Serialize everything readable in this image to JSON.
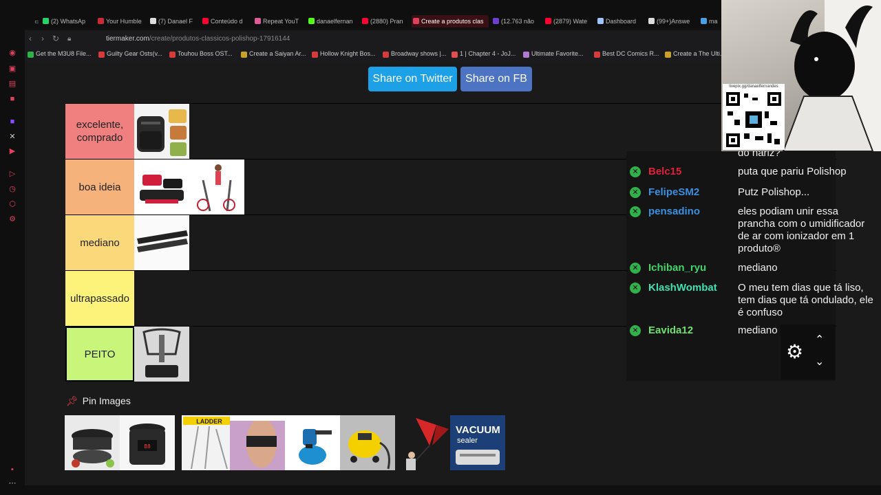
{
  "browser": {
    "tabs": [
      {
        "label": "(2) WhatsAp",
        "color": "#25d366"
      },
      {
        "label": "Your Humble",
        "color": "#cc2936"
      },
      {
        "label": "(7) Danael F",
        "color": "#dddddd"
      },
      {
        "label": "Conteúdo d",
        "color": "#ff0033"
      },
      {
        "label": "Repeat YouT",
        "color": "#e05a9a"
      },
      {
        "label": "danaelfernan",
        "color": "#53fc18"
      },
      {
        "label": "(2880) Pran",
        "color": "#ff0033"
      },
      {
        "label": "Create a produtos clas",
        "color": "#e0405a",
        "active": true
      },
      {
        "label": "(12.763 não",
        "color": "#6b3fd4"
      },
      {
        "label": "(2879) Wate",
        "color": "#ff0033"
      },
      {
        "label": "Dashboard",
        "color": "#a0c4ff"
      },
      {
        "label": "(99+)Answe",
        "color": "#dddddd"
      },
      {
        "label": "ma",
        "color": "#4aa0e6"
      }
    ],
    "url_host": "tiermaker.com",
    "url_path": "/create/produtos-classicos-polishop-17916144",
    "bookmarks": [
      {
        "label": "Get the M3U8 File...",
        "color": "#2fb24a"
      },
      {
        "label": "Guilty Gear Osts(v...",
        "color": "#d63a3a"
      },
      {
        "label": "Touhou Boss OST...",
        "color": "#d63a3a"
      },
      {
        "label": "Create a Saiyan Ar...",
        "color": "#c9a227"
      },
      {
        "label": "Hollow Knight Bos...",
        "color": "#d63a3a"
      },
      {
        "label": "Broadway shows |...",
        "color": "#d63a3a"
      },
      {
        "label": "1 | Chapter 4 - JoJ...",
        "color": "#e05050"
      },
      {
        "label": "Ultimate Favorite...",
        "color": "#b07ad0"
      },
      {
        "label": "Best DC Comics R...",
        "color": "#d63a3a"
      },
      {
        "label": "Create a The Ulti...",
        "color": "#c9a227"
      }
    ]
  },
  "share": {
    "twitter": "Share on Twitter",
    "facebook": "Share on FB"
  },
  "tiers": [
    {
      "label_line1": "excelente,",
      "label_line2": "comprado",
      "color": "#f08080"
    },
    {
      "label_line1": "boa ideia",
      "label_line2": "",
      "color": "#f5b27a"
    },
    {
      "label_line1": "mediano",
      "label_line2": "",
      "color": "#fbd87a"
    },
    {
      "label_line1": "ultrapassado",
      "label_line2": "",
      "color": "#fdf27a"
    },
    {
      "label_line1": "PEITO",
      "label_line2": "",
      "color": "#c8f57a"
    }
  ],
  "chat": {
    "partial_top": "do nariz?",
    "messages": [
      {
        "user": "Belc15",
        "color": "#e0203a",
        "text": "puta que pariu Polishop"
      },
      {
        "user": "FelipeSM2",
        "color": "#3b8fe0",
        "text": "Putz Polishop..."
      },
      {
        "user": "pensadino",
        "color": "#3b8fe0",
        "text": "eles podiam unir essa prancha com o umidificador de ar com ionizador em 1 produto®"
      },
      {
        "user": "Ichiban_ryu",
        "color": "#3fd46a",
        "text": "mediano"
      },
      {
        "user": "KlashWombat",
        "color": "#3fe0b0",
        "text": "O meu tem dias que tá liso, tem dias que tá ondulado, ele é confuso"
      },
      {
        "user": "Eavida12",
        "color": "#6fe06f",
        "text": "mediano"
      }
    ]
  },
  "cam_qr_caption": "livepix.gg/danaelfernandes",
  "pin_title": "Pin Images"
}
